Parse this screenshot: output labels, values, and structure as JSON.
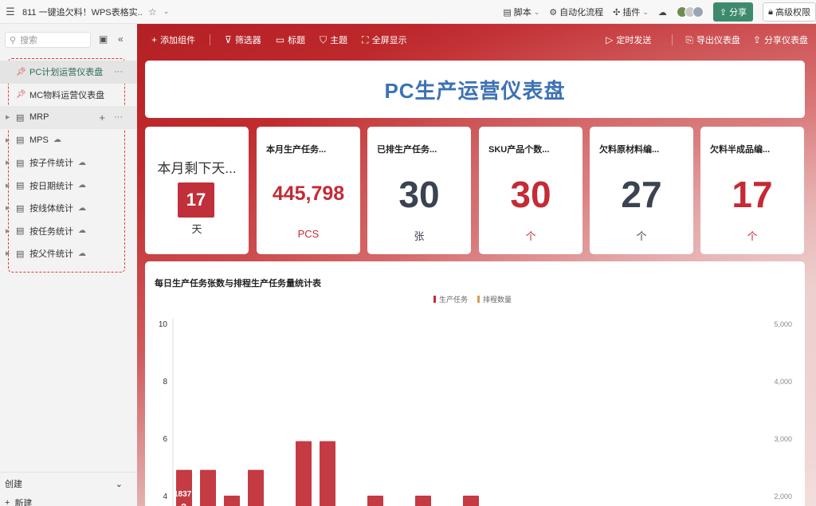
{
  "titlebar": {
    "title": "811 一键追欠料！WPS表格实...",
    "script_label": "脚本",
    "automation_label": "自动化流程",
    "plugin_label": "插件",
    "share_label": "分享",
    "permission_label": "高级权限"
  },
  "sidebar": {
    "search_placeholder": "搜索",
    "items": [
      {
        "label": "PC计划运营仪表盘",
        "type": "pinned"
      },
      {
        "label": "MC物料运营仪表盘",
        "type": "pinned"
      },
      {
        "label": "MRP",
        "type": "doc"
      },
      {
        "label": "MPS",
        "type": "doc"
      },
      {
        "label": "按子件统计",
        "type": "doc"
      },
      {
        "label": "按日期统计",
        "type": "doc"
      },
      {
        "label": "按线体统计",
        "type": "doc"
      },
      {
        "label": "按任务统计",
        "type": "doc"
      },
      {
        "label": "按父件统计",
        "type": "doc"
      }
    ],
    "create_label": "创建",
    "new_label": "新建"
  },
  "toolbar": {
    "add_widget": "添加组件",
    "filter": "筛选器",
    "heading": "标题",
    "theme": "主题",
    "fullscreen": "全屏显示",
    "scheduled_send": "定时发送",
    "export": "导出仪表盘",
    "share_dashboard": "分享仪表盘"
  },
  "dashboard": {
    "title": "PC生产运营仪表盘",
    "days_left": {
      "label": "本月剩下天...",
      "value": "17",
      "unit": "天"
    },
    "kpis": [
      {
        "label": "本月生产任务...",
        "value": "445,798",
        "unit": "PCS",
        "color": "red"
      },
      {
        "label": "已排生产任务...",
        "value": "30",
        "unit": "张",
        "color": "dark"
      },
      {
        "label": "SKU产品个数...",
        "value": "30",
        "unit": "个",
        "color": "red"
      },
      {
        "label": "欠料原材料编...",
        "value": "27",
        "unit": "个",
        "color": "dark"
      },
      {
        "label": "欠料半成品编...",
        "value": "17",
        "unit": "个",
        "color": "red"
      }
    ]
  },
  "colors": {
    "brand_green": "#3d8a6d",
    "kpi_red": "#c42b35",
    "kpi_dark": "#3b4350",
    "title_blue": "#3d72b4"
  },
  "chart_data": {
    "type": "bar",
    "title": "每日生产任务张数与排程生产任务量统计表",
    "legend": [
      "生产任务",
      "排程数量"
    ],
    "series": [
      {
        "name": "生产任务",
        "values": [
          4.9,
          4.9,
          4.0,
          4.9,
          null,
          5.9,
          5.9,
          null,
          4.0,
          null,
          4.0,
          null,
          4.0
        ]
      },
      {
        "name": "排程数量",
        "values": []
      }
    ],
    "y_left_ticks": [
      "10",
      "8",
      "6",
      "4"
    ],
    "y_right_ticks": [
      "5,000",
      "4,000",
      "3,000",
      "2,000"
    ],
    "ylim_left": [
      0,
      10
    ],
    "ylim_right": [
      0,
      5000
    ],
    "partial_label": "1837",
    "partial_label2": "2"
  }
}
